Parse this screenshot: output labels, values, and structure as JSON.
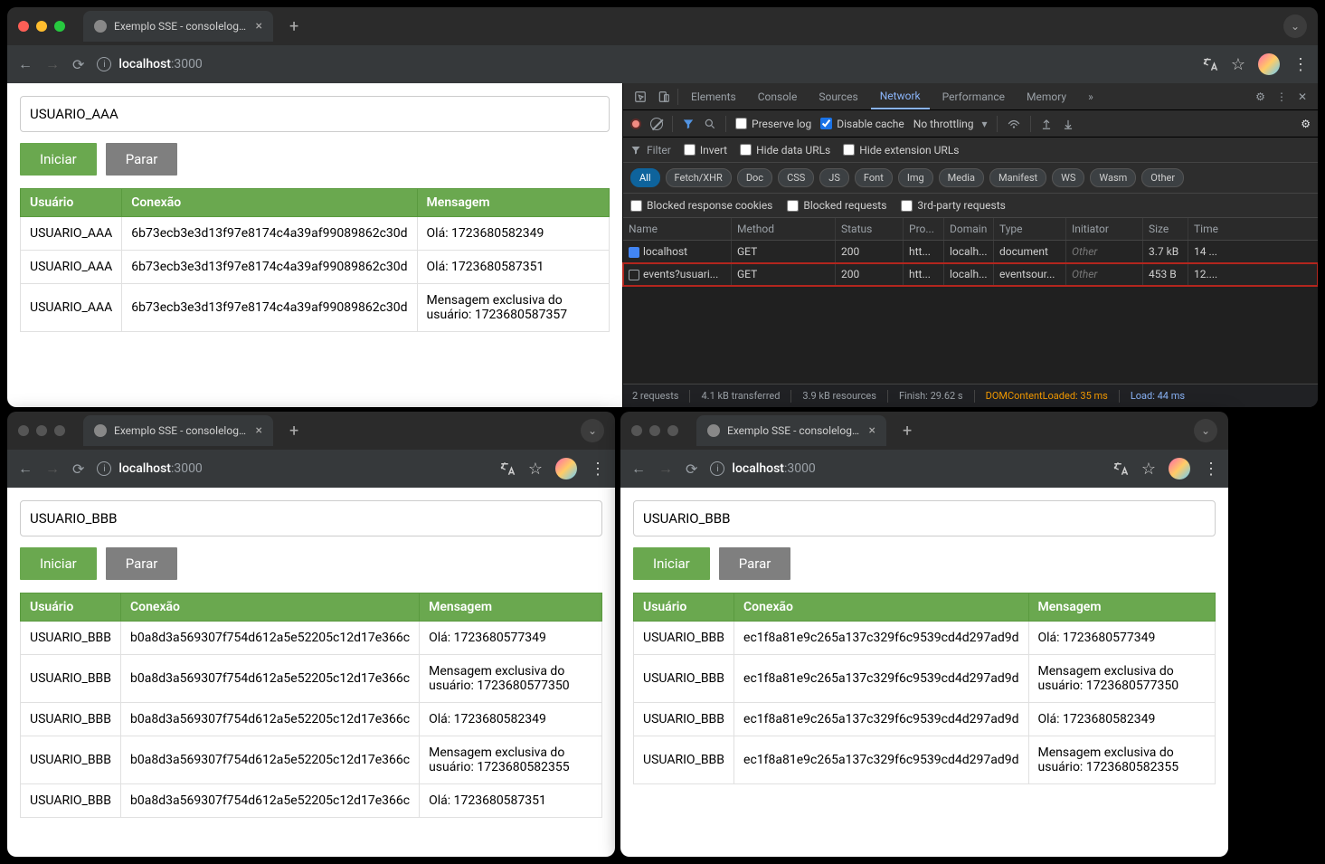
{
  "windows": {
    "main": {
      "traffic": "color",
      "tab_title": "Exemplo SSE - consolelog.co",
      "url_host": "localhost",
      "url_port": ":3000",
      "input_value": "USUARIO_AAA",
      "btn_start": "Iniciar",
      "btn_stop": "Parar",
      "headers": {
        "user": "Usuário",
        "conn": "Conexão",
        "msg": "Mensagem"
      },
      "rows": [
        {
          "user": "USUARIO_AAA",
          "conn": "6b73ecb3e3d13f97e8174c4a39af99089862c30d",
          "msg": "Olá: 1723680582349"
        },
        {
          "user": "USUARIO_AAA",
          "conn": "6b73ecb3e3d13f97e8174c4a39af99089862c30d",
          "msg": "Olá: 1723680587351"
        },
        {
          "user": "USUARIO_AAA",
          "conn": "6b73ecb3e3d13f97e8174c4a39af99089862c30d",
          "msg": "Mensagem exclusiva do usuário: 1723680587357"
        }
      ]
    },
    "bl": {
      "tab_title": "Exemplo SSE - consolelog.co",
      "url_host": "localhost",
      "url_port": ":3000",
      "input_value": "USUARIO_BBB",
      "btn_start": "Iniciar",
      "btn_stop": "Parar",
      "headers": {
        "user": "Usuário",
        "conn": "Conexão",
        "msg": "Mensagem"
      },
      "rows": [
        {
          "user": "USUARIO_BBB",
          "conn": "b0a8d3a569307f754d612a5e52205c12d17e366c",
          "msg": "Olá: 1723680577349"
        },
        {
          "user": "USUARIO_BBB",
          "conn": "b0a8d3a569307f754d612a5e52205c12d17e366c",
          "msg": "Mensagem exclusiva do usuário: 1723680577350"
        },
        {
          "user": "USUARIO_BBB",
          "conn": "b0a8d3a569307f754d612a5e52205c12d17e366c",
          "msg": "Olá: 1723680582349"
        },
        {
          "user": "USUARIO_BBB",
          "conn": "b0a8d3a569307f754d612a5e52205c12d17e366c",
          "msg": "Mensagem exclusiva do usuário: 1723680582355"
        },
        {
          "user": "USUARIO_BBB",
          "conn": "b0a8d3a569307f754d612a5e52205c12d17e366c",
          "msg": "Olá: 1723680587351"
        }
      ]
    },
    "br": {
      "tab_title": "Exemplo SSE - consolelog.co",
      "url_host": "localhost",
      "url_port": ":3000",
      "input_value": "USUARIO_BBB",
      "btn_start": "Iniciar",
      "btn_stop": "Parar",
      "headers": {
        "user": "Usuário",
        "conn": "Conexão",
        "msg": "Mensagem"
      },
      "rows": [
        {
          "user": "USUARIO_BBB",
          "conn": "ec1f8a81e9c265a137c329f6c9539cd4d297ad9d",
          "msg": "Olá: 1723680577349"
        },
        {
          "user": "USUARIO_BBB",
          "conn": "ec1f8a81e9c265a137c329f6c9539cd4d297ad9d",
          "msg": "Mensagem exclusiva do usuário: 1723680577350"
        },
        {
          "user": "USUARIO_BBB",
          "conn": "ec1f8a81e9c265a137c329f6c9539cd4d297ad9d",
          "msg": "Olá: 1723680582349"
        },
        {
          "user": "USUARIO_BBB",
          "conn": "ec1f8a81e9c265a137c329f6c9539cd4d297ad9d",
          "msg": "Mensagem exclusiva do usuário: 1723680582355"
        }
      ]
    }
  },
  "devtools": {
    "tabs": [
      "Elements",
      "Console",
      "Sources",
      "Network",
      "Performance",
      "Memory"
    ],
    "active_tab": "Network",
    "more_tabs": "»",
    "toolbar": {
      "preserve_log": "Preserve log",
      "disable_cache": "Disable cache",
      "throttling": "No throttling"
    },
    "filter_row": {
      "filter_placeholder": "Filter",
      "invert": "Invert",
      "hide_data": "Hide data URLs",
      "hide_ext": "Hide extension URLs"
    },
    "chips": [
      "All",
      "Fetch/XHR",
      "Doc",
      "CSS",
      "JS",
      "Font",
      "Img",
      "Media",
      "Manifest",
      "WS",
      "Wasm",
      "Other"
    ],
    "checks2": {
      "blocked_cookies": "Blocked response cookies",
      "blocked_req": "Blocked requests",
      "third_party": "3rd-party requests"
    },
    "columns": [
      "Name",
      "Method",
      "Status",
      "Pro...",
      "Domain",
      "Type",
      "Initiator",
      "Size",
      "Time"
    ],
    "requests": [
      {
        "name": "localhost",
        "method": "GET",
        "status": "200",
        "proto": "htt...",
        "domain": "localh...",
        "type": "document",
        "initiator": "Other",
        "size": "3.7 kB",
        "time": "14 ...",
        "icon": "doc",
        "hl": false
      },
      {
        "name": "events?usuari...",
        "method": "GET",
        "status": "200",
        "proto": "htt...",
        "domain": "localh...",
        "type": "eventsour...",
        "initiator": "Other",
        "size": "453 B",
        "time": "12....",
        "icon": "evt",
        "hl": true
      }
    ],
    "status": {
      "requests": "2 requests",
      "transferred": "4.1 kB transferred",
      "resources": "3.9 kB resources",
      "finish": "Finish: 29.62 s",
      "dcl": "DOMContentLoaded: 35 ms",
      "load": "Load: 44 ms"
    }
  }
}
